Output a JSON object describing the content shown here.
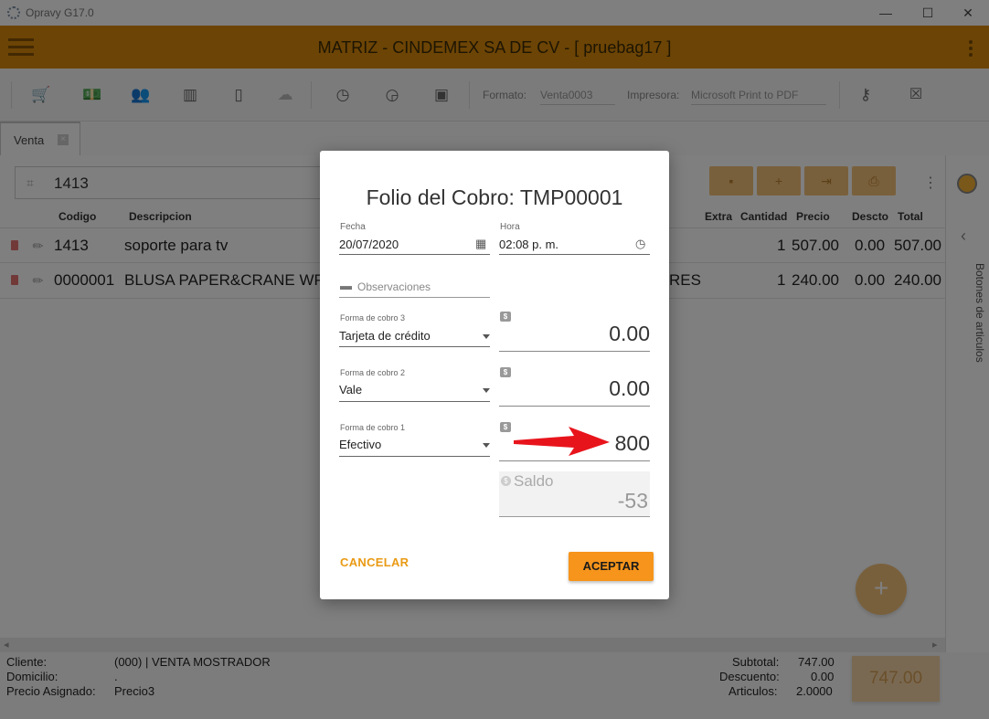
{
  "window": {
    "title": "Opravy G17.0",
    "minimize": "—",
    "maximize": "☐",
    "close": "✕"
  },
  "header": {
    "title": "MATRIZ - CINDEMEX SA DE CV - [ pruebag17 ]"
  },
  "toolbar": {
    "format_label": "Formato:",
    "format_value": "Venta0003",
    "printer_label": "Impresora:",
    "printer_value": "Microsoft Print to PDF"
  },
  "tabs": [
    {
      "label": "Venta"
    }
  ],
  "search": {
    "value": "1413"
  },
  "columns": {
    "code": "Codigo",
    "description": "Descripcion",
    "extra": "Extra",
    "quantity": "Cantidad",
    "price": "Precio",
    "discount": "Descto",
    "total": "Total"
  },
  "rows": [
    {
      "code": "1413",
      "description": "soporte para tv",
      "extra_tail": "",
      "quantity": "1",
      "price": "507.00",
      "discount": "0.00",
      "total": "507.00"
    },
    {
      "code": "0000001",
      "description": "BLUSA PAPER&CRANE WP",
      "extra_tail": "RES",
      "quantity": "1",
      "price": "240.00",
      "discount": "0.00",
      "total": "240.00"
    }
  ],
  "side_panel": {
    "label": "Botones de articulos"
  },
  "footer": {
    "client_label": "Cliente:",
    "client_value": "(000) | VENTA MOSTRADOR",
    "address_label": "Domicilio:",
    "address_value": ".",
    "price_label": "Precio Asignado:",
    "price_value": "Precio3",
    "subtotal_label": "Subtotal:",
    "subtotal_value": "747.00",
    "discount_label": "Descuento:",
    "discount_value": "0.00",
    "items_label": "Articulos:",
    "items_value": "2.0000",
    "total_button": "747.00"
  },
  "dialog": {
    "title": "Folio del Cobro: TMP00001",
    "date_label": "Fecha",
    "date_value": "20/07/2020",
    "time_label": "Hora",
    "time_value": "02:08 p. m.",
    "notes_placeholder": "Observaciones",
    "payments": [
      {
        "label": "Forma de cobro 3",
        "method": "Tarjeta de crédito",
        "amount": "0.00"
      },
      {
        "label": "Forma de cobro 2",
        "method": "Vale",
        "amount": "0.00"
      },
      {
        "label": "Forma de cobro 1",
        "method": "Efectivo",
        "amount": "800"
      }
    ],
    "balance_label": "Saldo",
    "balance_value": "-53",
    "cancel": "CANCELAR",
    "accept": "ACEPTAR"
  },
  "colors": {
    "brand": "#d9890b",
    "accept": "#f6941b",
    "arrow": "#e8141c"
  }
}
